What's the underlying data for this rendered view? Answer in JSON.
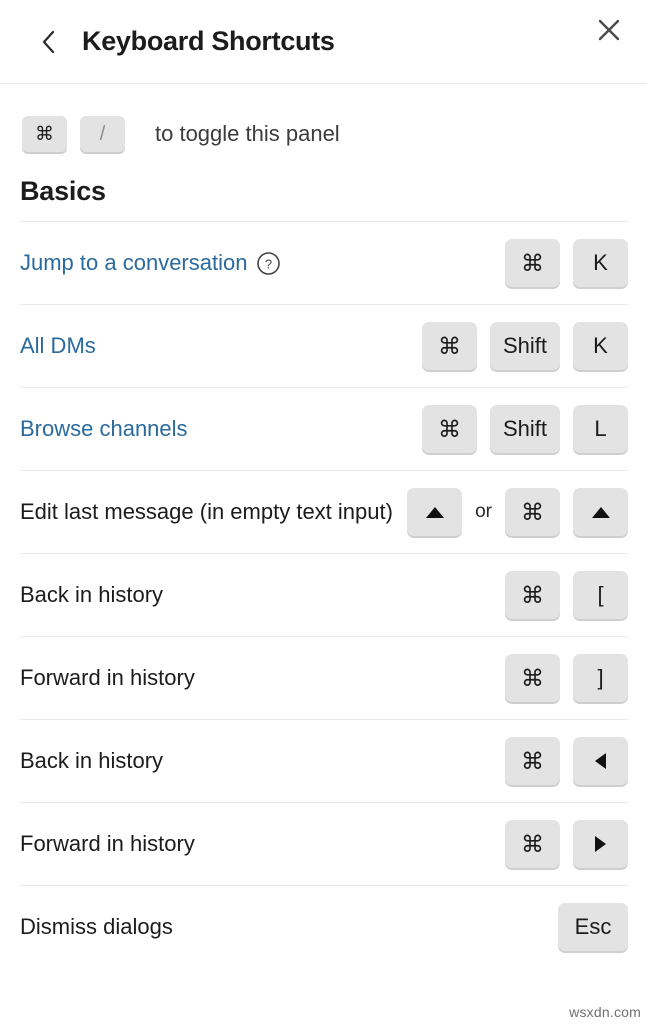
{
  "header": {
    "title": "Keyboard Shortcuts",
    "back_icon": "chevron-left-icon",
    "close_icon": "close-icon"
  },
  "toggle_hint": {
    "keys": [
      "⌘",
      "/"
    ],
    "text": "to toggle this panel"
  },
  "section": {
    "title": "Basics",
    "rows": [
      {
        "label": "Jump to a conversation",
        "is_link": true,
        "has_help": true,
        "keys": [
          {
            "type": "text",
            "value": "⌘"
          },
          {
            "type": "text",
            "value": "K"
          }
        ]
      },
      {
        "label": "All DMs",
        "is_link": true,
        "has_help": false,
        "keys": [
          {
            "type": "text",
            "value": "⌘"
          },
          {
            "type": "text",
            "value": "Shift",
            "wide": true
          },
          {
            "type": "text",
            "value": "K"
          }
        ]
      },
      {
        "label": "Browse channels",
        "is_link": true,
        "has_help": false,
        "keys": [
          {
            "type": "text",
            "value": "⌘"
          },
          {
            "type": "text",
            "value": "Shift",
            "wide": true
          },
          {
            "type": "text",
            "value": "L"
          }
        ]
      },
      {
        "label": "Edit last message (in empty text input)",
        "is_link": false,
        "has_help": false,
        "keys": [
          {
            "type": "arrow-up"
          },
          {
            "type": "separator",
            "value": "or"
          },
          {
            "type": "text",
            "value": "⌘"
          },
          {
            "type": "arrow-up"
          }
        ]
      },
      {
        "label": "Back in history",
        "is_link": false,
        "has_help": false,
        "keys": [
          {
            "type": "text",
            "value": "⌘"
          },
          {
            "type": "text",
            "value": "["
          }
        ]
      },
      {
        "label": "Forward in history",
        "is_link": false,
        "has_help": false,
        "keys": [
          {
            "type": "text",
            "value": "⌘"
          },
          {
            "type": "text",
            "value": "]"
          }
        ]
      },
      {
        "label": "Back in history",
        "is_link": false,
        "has_help": false,
        "keys": [
          {
            "type": "text",
            "value": "⌘"
          },
          {
            "type": "arrow-left"
          }
        ]
      },
      {
        "label": "Forward in history",
        "is_link": false,
        "has_help": false,
        "keys": [
          {
            "type": "text",
            "value": "⌘"
          },
          {
            "type": "arrow-right"
          }
        ]
      },
      {
        "label": "Dismiss dialogs",
        "is_link": false,
        "has_help": false,
        "keys": [
          {
            "type": "text",
            "value": "Esc",
            "wide": true
          }
        ]
      }
    ]
  },
  "watermark": "wsxdn.com",
  "colors": {
    "link": "#2a6a9e",
    "text": "#1d1c1d",
    "keycap_bg": "#e3e3e3",
    "keycap_shadow": "#cfcfcf",
    "divider": "#e9e9e9"
  }
}
